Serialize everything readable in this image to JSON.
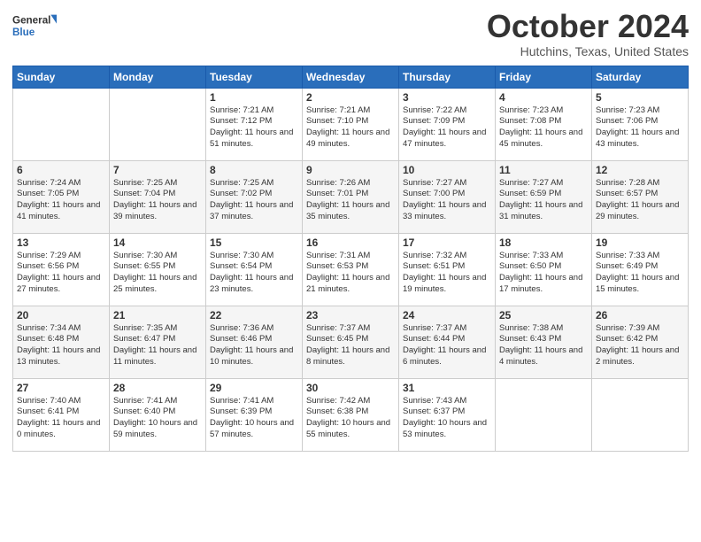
{
  "header": {
    "logo_general": "General",
    "logo_blue": "Blue",
    "month_title": "October 2024",
    "location": "Hutchins, Texas, United States"
  },
  "calendar": {
    "days_of_week": [
      "Sunday",
      "Monday",
      "Tuesday",
      "Wednesday",
      "Thursday",
      "Friday",
      "Saturday"
    ],
    "weeks": [
      [
        {
          "day": "",
          "info": ""
        },
        {
          "day": "",
          "info": ""
        },
        {
          "day": "1",
          "info": "Sunrise: 7:21 AM\nSunset: 7:12 PM\nDaylight: 11 hours and 51 minutes."
        },
        {
          "day": "2",
          "info": "Sunrise: 7:21 AM\nSunset: 7:10 PM\nDaylight: 11 hours and 49 minutes."
        },
        {
          "day": "3",
          "info": "Sunrise: 7:22 AM\nSunset: 7:09 PM\nDaylight: 11 hours and 47 minutes."
        },
        {
          "day": "4",
          "info": "Sunrise: 7:23 AM\nSunset: 7:08 PM\nDaylight: 11 hours and 45 minutes."
        },
        {
          "day": "5",
          "info": "Sunrise: 7:23 AM\nSunset: 7:06 PM\nDaylight: 11 hours and 43 minutes."
        }
      ],
      [
        {
          "day": "6",
          "info": "Sunrise: 7:24 AM\nSunset: 7:05 PM\nDaylight: 11 hours and 41 minutes."
        },
        {
          "day": "7",
          "info": "Sunrise: 7:25 AM\nSunset: 7:04 PM\nDaylight: 11 hours and 39 minutes."
        },
        {
          "day": "8",
          "info": "Sunrise: 7:25 AM\nSunset: 7:02 PM\nDaylight: 11 hours and 37 minutes."
        },
        {
          "day": "9",
          "info": "Sunrise: 7:26 AM\nSunset: 7:01 PM\nDaylight: 11 hours and 35 minutes."
        },
        {
          "day": "10",
          "info": "Sunrise: 7:27 AM\nSunset: 7:00 PM\nDaylight: 11 hours and 33 minutes."
        },
        {
          "day": "11",
          "info": "Sunrise: 7:27 AM\nSunset: 6:59 PM\nDaylight: 11 hours and 31 minutes."
        },
        {
          "day": "12",
          "info": "Sunrise: 7:28 AM\nSunset: 6:57 PM\nDaylight: 11 hours and 29 minutes."
        }
      ],
      [
        {
          "day": "13",
          "info": "Sunrise: 7:29 AM\nSunset: 6:56 PM\nDaylight: 11 hours and 27 minutes."
        },
        {
          "day": "14",
          "info": "Sunrise: 7:30 AM\nSunset: 6:55 PM\nDaylight: 11 hours and 25 minutes."
        },
        {
          "day": "15",
          "info": "Sunrise: 7:30 AM\nSunset: 6:54 PM\nDaylight: 11 hours and 23 minutes."
        },
        {
          "day": "16",
          "info": "Sunrise: 7:31 AM\nSunset: 6:53 PM\nDaylight: 11 hours and 21 minutes."
        },
        {
          "day": "17",
          "info": "Sunrise: 7:32 AM\nSunset: 6:51 PM\nDaylight: 11 hours and 19 minutes."
        },
        {
          "day": "18",
          "info": "Sunrise: 7:33 AM\nSunset: 6:50 PM\nDaylight: 11 hours and 17 minutes."
        },
        {
          "day": "19",
          "info": "Sunrise: 7:33 AM\nSunset: 6:49 PM\nDaylight: 11 hours and 15 minutes."
        }
      ],
      [
        {
          "day": "20",
          "info": "Sunrise: 7:34 AM\nSunset: 6:48 PM\nDaylight: 11 hours and 13 minutes."
        },
        {
          "day": "21",
          "info": "Sunrise: 7:35 AM\nSunset: 6:47 PM\nDaylight: 11 hours and 11 minutes."
        },
        {
          "day": "22",
          "info": "Sunrise: 7:36 AM\nSunset: 6:46 PM\nDaylight: 11 hours and 10 minutes."
        },
        {
          "day": "23",
          "info": "Sunrise: 7:37 AM\nSunset: 6:45 PM\nDaylight: 11 hours and 8 minutes."
        },
        {
          "day": "24",
          "info": "Sunrise: 7:37 AM\nSunset: 6:44 PM\nDaylight: 11 hours and 6 minutes."
        },
        {
          "day": "25",
          "info": "Sunrise: 7:38 AM\nSunset: 6:43 PM\nDaylight: 11 hours and 4 minutes."
        },
        {
          "day": "26",
          "info": "Sunrise: 7:39 AM\nSunset: 6:42 PM\nDaylight: 11 hours and 2 minutes."
        }
      ],
      [
        {
          "day": "27",
          "info": "Sunrise: 7:40 AM\nSunset: 6:41 PM\nDaylight: 11 hours and 0 minutes."
        },
        {
          "day": "28",
          "info": "Sunrise: 7:41 AM\nSunset: 6:40 PM\nDaylight: 10 hours and 59 minutes."
        },
        {
          "day": "29",
          "info": "Sunrise: 7:41 AM\nSunset: 6:39 PM\nDaylight: 10 hours and 57 minutes."
        },
        {
          "day": "30",
          "info": "Sunrise: 7:42 AM\nSunset: 6:38 PM\nDaylight: 10 hours and 55 minutes."
        },
        {
          "day": "31",
          "info": "Sunrise: 7:43 AM\nSunset: 6:37 PM\nDaylight: 10 hours and 53 minutes."
        },
        {
          "day": "",
          "info": ""
        },
        {
          "day": "",
          "info": ""
        }
      ]
    ]
  }
}
